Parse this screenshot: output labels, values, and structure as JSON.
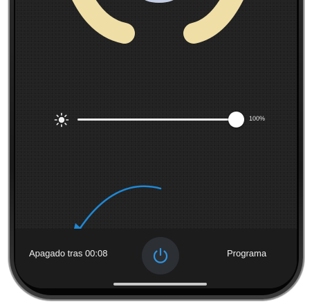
{
  "brightness": {
    "icon": "sun-icon",
    "level": 1.0,
    "value_label": "100%"
  },
  "bottom_bar": {
    "timer_label": "Apagado tras 00:08",
    "power_icon": "power-icon",
    "program_label": "Programa"
  },
  "annotation": {
    "icon": "curved-arrow-icon",
    "color": "#1e88d6"
  },
  "colors": {
    "lamp": "#efdea6",
    "accent": "#1e88d6",
    "screen_bg": "#222222"
  }
}
